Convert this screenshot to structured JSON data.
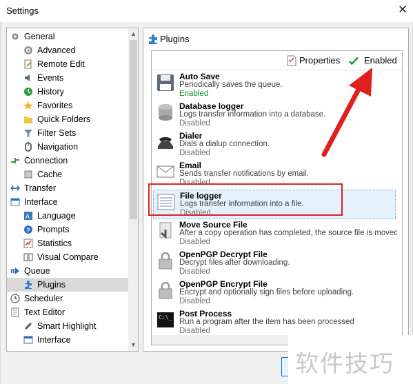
{
  "window": {
    "title": "Settings",
    "close_glyph": "✕"
  },
  "tree": {
    "items": [
      {
        "label": "General",
        "icon": "gear-icon",
        "indent": 0
      },
      {
        "label": "Advanced",
        "icon": "gear-small-icon",
        "indent": 1
      },
      {
        "label": "Remote Edit",
        "icon": "document-edit-icon",
        "indent": 1
      },
      {
        "label": "Events",
        "icon": "speaker-icon",
        "indent": 1
      },
      {
        "label": "History",
        "icon": "history-icon",
        "indent": 1
      },
      {
        "label": "Favorites",
        "icon": "star-icon",
        "indent": 1
      },
      {
        "label": "Quick Folders",
        "icon": "folder-icon",
        "indent": 1
      },
      {
        "label": "Filter Sets",
        "icon": "filter-icon",
        "indent": 1
      },
      {
        "label": "Navigation",
        "icon": "mouse-icon",
        "indent": 1
      },
      {
        "label": "Connection",
        "icon": "connection-icon",
        "indent": 0
      },
      {
        "label": "Cache",
        "icon": "cache-icon",
        "indent": 1
      },
      {
        "label": "Transfer",
        "icon": "transfer-arrows-icon",
        "indent": 0
      },
      {
        "label": "Interface",
        "icon": "window-icon",
        "indent": 0
      },
      {
        "label": "Language",
        "icon": "language-icon",
        "indent": 1
      },
      {
        "label": "Prompts",
        "icon": "question-icon",
        "indent": 1
      },
      {
        "label": "Statistics",
        "icon": "statistics-icon",
        "indent": 1
      },
      {
        "label": "Visual Compare",
        "icon": "compare-icon",
        "indent": 1
      },
      {
        "label": "Queue",
        "icon": "queue-icon",
        "indent": 0
      },
      {
        "label": "Plugins",
        "icon": "puzzle-icon",
        "indent": 1,
        "selected": true
      },
      {
        "label": "Scheduler",
        "icon": "clock-icon",
        "indent": 0
      },
      {
        "label": "Text Editor",
        "icon": "text-document-icon",
        "indent": 0
      },
      {
        "label": "Smart Highlight",
        "icon": "highlight-icon",
        "indent": 1
      },
      {
        "label": "Interface",
        "icon": "window-icon",
        "indent": 1
      }
    ]
  },
  "panel": {
    "title": "Plugins",
    "toolbar": {
      "properties_label": "Properties",
      "enabled_label": "Enabled"
    },
    "plugins": [
      {
        "name": "Auto Save",
        "description": "Periodically saves the queue.",
        "status": "Enabled",
        "icon": "floppy-disk-icon"
      },
      {
        "name": "Database logger",
        "description": "Logs transfer information into a database.",
        "status": "Disabled",
        "icon": "database-icon"
      },
      {
        "name": "Dialer",
        "description": "Dials a dialup connection.",
        "status": "Disabled",
        "icon": "phone-icon"
      },
      {
        "name": "Email",
        "description": "Sends transfer notifications by email.",
        "status": "Disabled",
        "icon": "envelope-icon"
      },
      {
        "name": "File logger",
        "description": "Logs transfer information into a file.",
        "status": "Disabled",
        "icon": "log-file-icon",
        "selected": true
      },
      {
        "name": "Move Source File",
        "description": "After a copy operation has completed, the source file is moved...",
        "status": "Disabled",
        "icon": "move-file-icon"
      },
      {
        "name": "OpenPGP Decrypt File",
        "description": "Decrypt files after downloading.",
        "status": "Disabled",
        "icon": "padlock-icon"
      },
      {
        "name": "OpenPGP Encrypt File",
        "description": "Encrypt and optionally sign files before uploading.",
        "status": "Disabled",
        "icon": "padlock-icon"
      },
      {
        "name": "Post Process",
        "description": "Run a program after the item has been processed",
        "status": "Disabled",
        "icon": "console-icon"
      }
    ]
  },
  "watermark": {
    "text": "软件技巧"
  },
  "colors": {
    "selection": "#e5f1fb",
    "annotation_red": "#e02020",
    "enabled_green": "#1b8f2a"
  }
}
